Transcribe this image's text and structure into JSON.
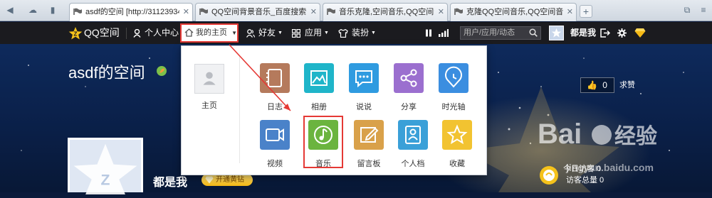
{
  "browser": {
    "tabs": [
      {
        "title": "asdf的空间 [http://311239341"
      },
      {
        "title": "QQ空间背景音乐_百度搜索"
      },
      {
        "title": "音乐克隆,空间音乐,QQ空间音乐"
      },
      {
        "title": "克隆QQ空间音乐,QQ空间音乐盒"
      }
    ],
    "new_tab": "+"
  },
  "topbar": {
    "logo": "QQ空间",
    "personal_center": "个人中心",
    "my_home": "我的主页",
    "friends": "好友",
    "apps": "应用",
    "dressup": "装扮",
    "search_placeholder": "用户/应用/动态",
    "username": "都是我"
  },
  "dropdown": {
    "home_label": "主页",
    "apps": [
      {
        "label": "日志",
        "icon": "diary-icon",
        "color": "#b57a5c"
      },
      {
        "label": "相册",
        "icon": "photo-icon",
        "color": "#1fb5c9"
      },
      {
        "label": "说说",
        "icon": "chat-icon",
        "color": "#2f9be0"
      },
      {
        "label": "分享",
        "icon": "share-icon",
        "color": "#9b6fcf"
      },
      {
        "label": "时光轴",
        "icon": "timeline-icon",
        "color": "#3b8ee0"
      },
      {
        "label": "视频",
        "icon": "video-icon",
        "color": "#4a82c9"
      },
      {
        "label": "音乐",
        "icon": "music-icon",
        "color": "#6bb43f"
      },
      {
        "label": "留言板",
        "icon": "guestbook-icon",
        "color": "#d9a14a"
      },
      {
        "label": "个人档",
        "icon": "profile-icon",
        "color": "#3aa0d8"
      },
      {
        "label": "收藏",
        "icon": "star-icon",
        "color": "#f2c331"
      }
    ]
  },
  "profile": {
    "space_title": "asdf的空间",
    "nickname": "都是我",
    "vip_label": "开通黄钻",
    "like_count": "0",
    "like_label": "求赞",
    "visits_today": "今日访客 0",
    "visits_total": "访客总量 0"
  },
  "watermark": {
    "brand": "Bai du 经验",
    "url": "jingyan.baidu.com"
  }
}
